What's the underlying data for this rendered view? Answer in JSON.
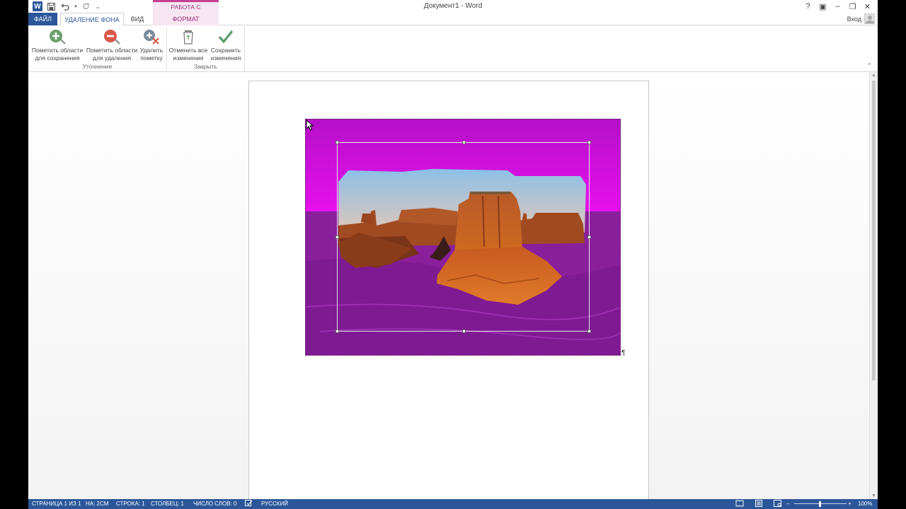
{
  "title_bar": {
    "doc_title": "Документ1 - Word",
    "contextual_header": "РАБОТА С РИСУНКАМИ",
    "help": "?",
    "ribbon_options": "▣",
    "minimize": "–",
    "restore": "❐",
    "close": "✕"
  },
  "quick_access": {
    "save_icon": "save-icon",
    "undo_icon": "undo-icon",
    "redo_icon": "redo-icon",
    "customize": "⌄"
  },
  "tabs": {
    "file": "ФАЙЛ",
    "background_removal": "УДАЛЕНИЕ ФОНА",
    "view": "ВИД",
    "format": "ФОРМАТ"
  },
  "account": {
    "signin": "Вход"
  },
  "ribbon": {
    "refine": {
      "label": "Уточнение",
      "mark_keep_line1": "Пометить области",
      "mark_keep_line2": "для сохранения",
      "mark_remove_line1": "Пометить области",
      "mark_remove_line2": "для удаления",
      "delete_mark_line1": "Удалить",
      "delete_mark_line2": "пометку"
    },
    "close_group": {
      "label": "Закрыть",
      "discard_line1": "Отменить все",
      "discard_line2": "изменения",
      "keep_line1": "Сохранить",
      "keep_line2": "изменения"
    }
  },
  "colors": {
    "accent": "#2b579a",
    "contextual": "#c64091",
    "removal_overlay": "#c010d0"
  },
  "status_bar": {
    "page": "СТРАНИЦА 1 ИЗ 1",
    "position": "НА: 2СМ",
    "line": "СТРОКА: 1",
    "column": "СТОЛБЕЦ: 1",
    "word_count": "ЧИСЛО СЛОВ: 0",
    "language": "РУССКИЙ",
    "zoom_minus": "–",
    "zoom_plus": "+",
    "zoom": "100%"
  },
  "document": {
    "paragraph_mark": "¶"
  }
}
